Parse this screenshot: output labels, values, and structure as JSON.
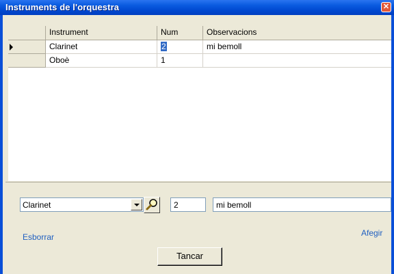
{
  "window": {
    "title": "Instruments de l'orquestra",
    "close_glyph": "✕"
  },
  "grid": {
    "columns": [
      "Instrument",
      "Num",
      "Observacions"
    ],
    "rows": [
      {
        "instrument": "Clarinet",
        "num": "2",
        "obs": "mi bemoll",
        "current": true
      },
      {
        "instrument": "Oboè",
        "num": "1",
        "obs": "",
        "current": false
      }
    ]
  },
  "editor": {
    "instrument_value": "Clarinet",
    "num_value": "2",
    "obs_value": "mi bemoll"
  },
  "actions": {
    "esborrar": "Esborrar",
    "afegir": "Afegir",
    "tancar": "Tancar"
  },
  "colors": {
    "titlebar": "#0054e3",
    "selection": "#316ac5",
    "link": "#1f5fc0"
  }
}
